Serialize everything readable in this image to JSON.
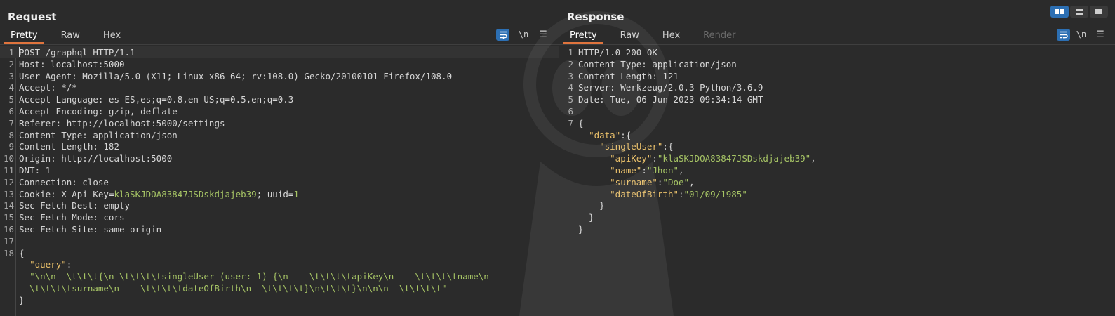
{
  "request": {
    "title": "Request",
    "tabs": [
      "Pretty",
      "Raw",
      "Hex"
    ],
    "newline_label": "\\n",
    "menu_label": "☰",
    "lines": [
      "POST /graphql HTTP/1.1",
      "Host: localhost:5000",
      "User-Agent: Mozilla/5.0 (X11; Linux x86_64; rv:108.0) Gecko/20100101 Firefox/108.0",
      "Accept: */*",
      "Accept-Language: es-ES,es;q=0.8,en-US;q=0.5,en;q=0.3",
      "Accept-Encoding: gzip, deflate",
      "Referer: http://localhost:5000/settings",
      "Content-Type: application/json",
      "Content-Length: 182",
      "Origin: http://localhost:5000",
      "DNT: 1",
      "Connection: close",
      "Cookie: X-Api-Key=klaSKJDOA83847JSDskdjajeb39; uuid=1",
      "Sec-Fetch-Dest: empty",
      "Sec-Fetch-Mode: cors",
      "Sec-Fetch-Site: same-origin",
      "",
      "{",
      "  \"query\":",
      "  \"\\n\\n  \\t\\t\\t{\\n \\t\\t\\t\\tsingleUser (user: 1) {\\n    \\t\\t\\t\\tapiKey\\n    \\t\\t\\t\\tname\\n",
      "  \\t\\t\\t\\tsurname\\n    \\t\\t\\t\\tdateOfBirth\\n  \\t\\t\\t\\t}\\n\\t\\t\\t}\\n\\n\\n  \\t\\t\\t\\t\"",
      "}"
    ],
    "line_numbers": [
      "1",
      "2",
      "3",
      "4",
      "5",
      "6",
      "7",
      "8",
      "9",
      "10",
      "11",
      "12",
      "13",
      "14",
      "15",
      "16",
      "17",
      "18",
      "",
      "",
      "",
      ""
    ]
  },
  "response": {
    "title": "Response",
    "tabs": [
      "Pretty",
      "Raw",
      "Hex",
      "Render"
    ],
    "newline_label": "\\n",
    "menu_label": "☰",
    "lines": [
      "HTTP/1.0 200 OK",
      "Content-Type: application/json",
      "Content-Length: 121",
      "Server: Werkzeug/2.0.3 Python/3.6.9",
      "Date: Tue, 06 Jun 2023 09:34:14 GMT",
      "",
      "{",
      "  \"data\":{",
      "    \"singleUser\":{",
      "      \"apiKey\":\"klaSKJDOA83847JSDskdjajeb39\",",
      "      \"name\":\"Jhon\",",
      "      \"surname\":\"Doe\",",
      "      \"dateOfBirth\":\"01/09/1985\"",
      "    }",
      "  }",
      "}"
    ],
    "line_numbers": [
      "1",
      "2",
      "3",
      "4",
      "5",
      "6",
      "7",
      "",
      "",
      "",
      "",
      "",
      "",
      "",
      "",
      ""
    ]
  },
  "colors": {
    "accent_tab": "#e0743d",
    "button_blue": "#2c6fb3",
    "json_key": "#e8bf6a",
    "json_string": "#a6c465"
  }
}
